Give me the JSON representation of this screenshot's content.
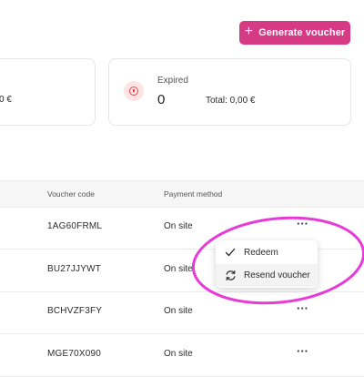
{
  "header": {
    "generate_label": "Generate voucher"
  },
  "cards": {
    "left": {
      "amount": "0 €"
    },
    "expired": {
      "label": "Expired",
      "count": "0",
      "total": "Total: 0,00 €"
    }
  },
  "table": {
    "headers": {
      "code": "Voucher code",
      "payment": "Payment method"
    },
    "rows": [
      {
        "code": "1AG60FRML",
        "payment": "On site"
      },
      {
        "code": "BU27JJYWT",
        "payment": "On site"
      },
      {
        "code": "BCHVZF3FY",
        "payment": "On site"
      },
      {
        "code": "MGE70X090",
        "payment": "On site"
      }
    ]
  },
  "menu": {
    "redeem": "Redeem",
    "resend": "Resend voucher"
  },
  "colors": {
    "accent": "#d63a84",
    "highlight": "#e83ad8",
    "expired": "#e04848"
  },
  "icons": {
    "plus": "plus-icon",
    "expired": "alert-circle-icon",
    "redeem": "check-icon",
    "resend": "refresh-icon",
    "more": "more-horizontal-icon"
  }
}
